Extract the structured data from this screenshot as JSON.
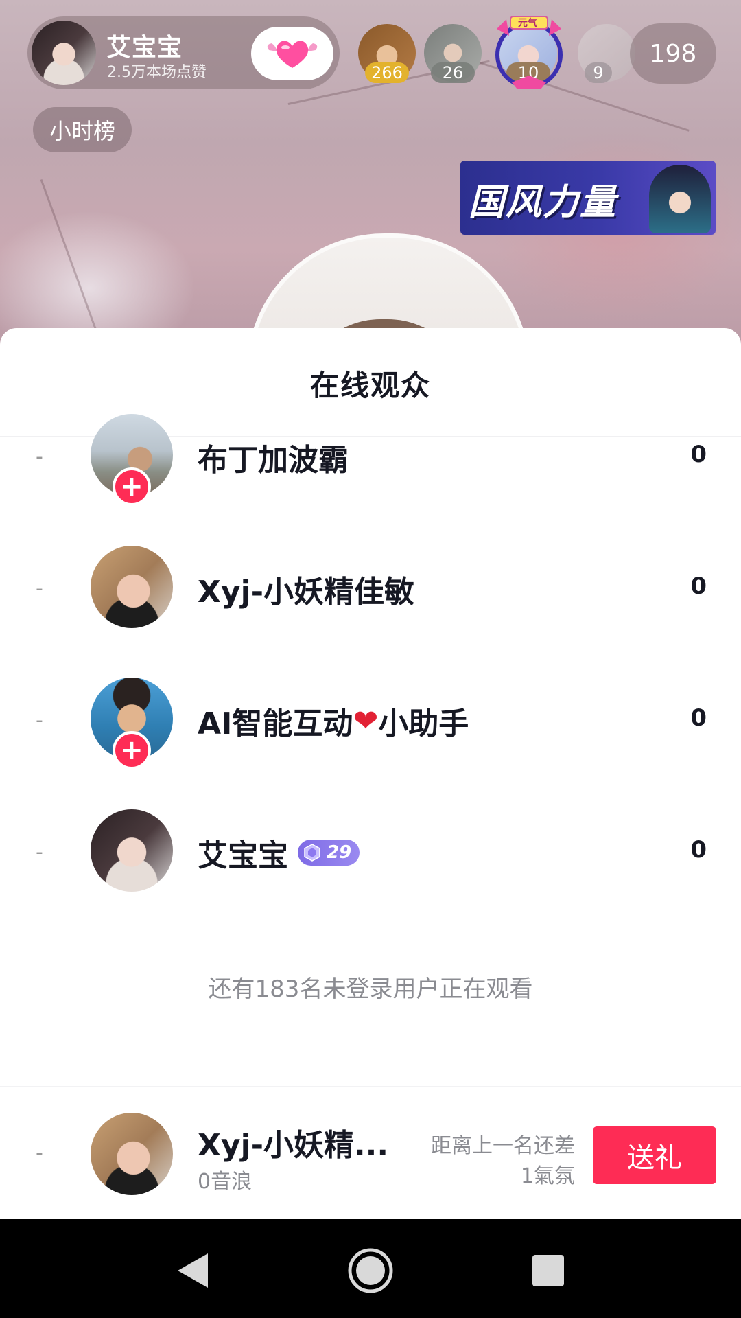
{
  "header": {
    "host_name": "艾宝宝",
    "host_likes": "2.5万本场点赞",
    "top_viewers": [
      {
        "count": "266",
        "badge_color": "#e3b22d"
      },
      {
        "count": "26",
        "badge_color": "#8a8f86"
      },
      {
        "count": "10",
        "badge_color": "#9a7c5a"
      },
      {
        "count": "9",
        "badge_color": "#bdb4b7"
      }
    ],
    "crown_label": "元气",
    "online_count": "198",
    "hourly_rank_label": "小时榜",
    "promo_text": "国风力量"
  },
  "sheet": {
    "title": "在线观众",
    "rows": [
      {
        "rank": "-",
        "name": "布丁加波霸",
        "score": "0",
        "has_follow": true
      },
      {
        "rank": "-",
        "name": "Xyj-小妖精佳敏",
        "score": "0",
        "has_follow": false
      },
      {
        "rank": "-",
        "name_pre": "AI智能互动",
        "name_heart": "❤",
        "name_post": "小助手",
        "score": "0",
        "has_follow": true
      },
      {
        "rank": "-",
        "name": "艾宝宝",
        "level": "29",
        "score": "0",
        "has_follow": false
      }
    ],
    "follow_symbol": "+",
    "guest_note": "还有183名未登录用户正在观看"
  },
  "my_rank": {
    "rank": "-",
    "name": "Xyj-小妖精...",
    "score": "0音浪",
    "gap_line1": "距离上一名还差",
    "gap_line2": "1氣氛",
    "gift_button": "送礼"
  },
  "colors": {
    "accent": "#fe2c55",
    "text": "#161823",
    "muted": "#8a8b91",
    "level_badge": "#7e6be6"
  },
  "icons": {
    "heart_button": "heart-icon",
    "nav_back": "back-triangle-icon",
    "nav_home": "home-circle-icon",
    "nav_recent": "recent-square-icon"
  }
}
